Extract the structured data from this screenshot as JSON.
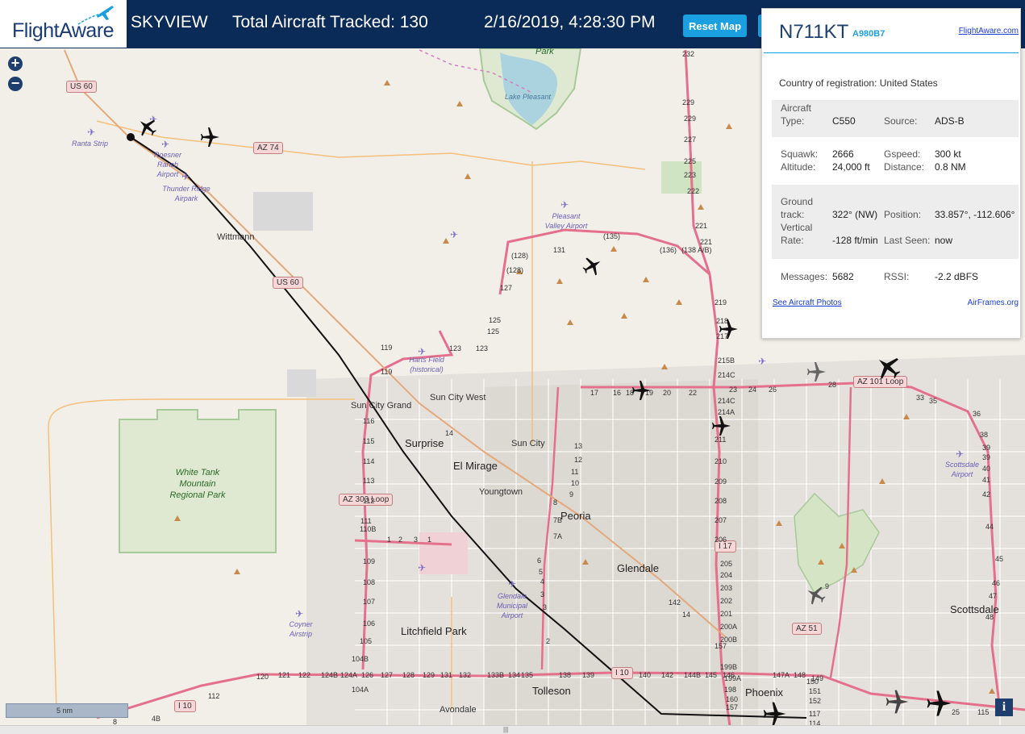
{
  "header": {
    "logo_text": "FlightAware",
    "app_name": "SKYVIEW",
    "aircraft_count_label": "Total Aircraft Tracked: 130",
    "datetime": "2/16/2019, 4:28:30 PM",
    "reset_button": "Reset Map"
  },
  "panel": {
    "ident": "N711KT",
    "hex": "A980B7",
    "fa_link": "FlightAware.com",
    "country_label": "Country of registration:",
    "country": "United States",
    "aircraft_type_label_1": "Aircraft",
    "aircraft_type_label_2": "Type:",
    "aircraft_type": "C550",
    "source_label": "Source:",
    "source": "ADS-B",
    "squawk_label": "Squawk:",
    "squawk": "2666",
    "gspeed_label": "Gspeed:",
    "gspeed": "300 kt",
    "altitude_label": "Altitude:",
    "altitude": "24,000 ft",
    "distance_label": "Distance:",
    "distance": "0.8 NM",
    "ground_label_1": "Ground",
    "ground_label_2": "track:",
    "ground_track": "322° (NW)",
    "position_label": "Position:",
    "position": "33.857°, -112.606°",
    "vrate_label_1": "Vertical",
    "vrate_label_2": "Rate:",
    "vrate": "-128 ft/min",
    "lastseen_label": "Last Seen:",
    "lastseen": "now",
    "messages_label": "Messages:",
    "messages": "5682",
    "rssi_label": "RSSI:",
    "rssi": "-2.2 dBFS",
    "photos_link": "See Aircraft Photos",
    "airframes_link": "AirFrames.org"
  },
  "map": {
    "zoom_in": "+",
    "zoom_out": "−",
    "scale": "5 nm",
    "info": "i",
    "scroll_grip": "|||",
    "cities": [
      "Surprise",
      "El Mirage",
      "Peoria",
      "Glendale",
      "Litchfield Park",
      "Tolleson",
      "Phoenix",
      "Scottsdale"
    ],
    "towns": [
      "Wittmann",
      "Sun City Grand",
      "Sun City West",
      "Sun City",
      "Youngtown",
      "Avondale"
    ],
    "airports": [
      "Ranta Strip",
      "Roesner Ranch Airport",
      "Thunder Ridge Airpark",
      "Pleasant Valley Airport",
      "Harts Field (historical)",
      "Glendale Municipal Airport",
      "Coyner Airstrip",
      "Scottsdale Airport"
    ],
    "water": "Lake Pleasant",
    "park_top": "Park",
    "park": "White Tank Mountain Regional Park",
    "routes": [
      "US 60",
      "AZ 74",
      "US 60",
      "AZ 303 Loop",
      "AZ 101 Loop",
      "I 17",
      "AZ 51",
      "I 10",
      "I 10"
    ],
    "exit_numbers": [
      "232",
      "229",
      "229",
      "227",
      "225",
      "223",
      "222",
      "221",
      "221",
      "(138 A/B)",
      "(136)",
      "(135)",
      "131",
      "(128)",
      "(128)",
      "127",
      "125",
      "125",
      "123",
      "123",
      "119",
      "119",
      "116",
      "115",
      "114",
      "113",
      "112",
      "111",
      "110B",
      "109",
      "108",
      "107",
      "106",
      "105",
      "104B",
      "104A",
      "219",
      "218",
      "217",
      "215B",
      "214C",
      "214C",
      "214A",
      "211",
      "210",
      "209",
      "208",
      "207",
      "206",
      "205",
      "204",
      "203",
      "202",
      "201",
      "200A",
      "200B",
      "199B",
      "199A",
      "198",
      "160",
      "157",
      "157",
      "142",
      "14",
      "14",
      "13",
      "12",
      "11",
      "10",
      "9",
      "8",
      "7B",
      "7A",
      "6",
      "5",
      "4",
      "3",
      "3",
      "2",
      "1",
      "1",
      "2",
      "3",
      "17",
      "16",
      "18",
      "19",
      "20",
      "22",
      "23",
      "24",
      "26",
      "28",
      "33",
      "35",
      "36",
      "38",
      "39",
      "39",
      "40",
      "41",
      "42",
      "44",
      "45",
      "46",
      "47",
      "48",
      "120",
      "121",
      "122",
      "124B",
      "124A",
      "126",
      "127",
      "128",
      "129",
      "131",
      "132",
      "133B",
      "134",
      "135",
      "138",
      "139",
      "140",
      "142",
      "144B",
      "145",
      "146",
      "147A",
      "148",
      "149",
      "150",
      "151",
      "152",
      "117",
      "114",
      "112",
      "4B",
      "8",
      "9",
      "25",
      "115"
    ]
  }
}
